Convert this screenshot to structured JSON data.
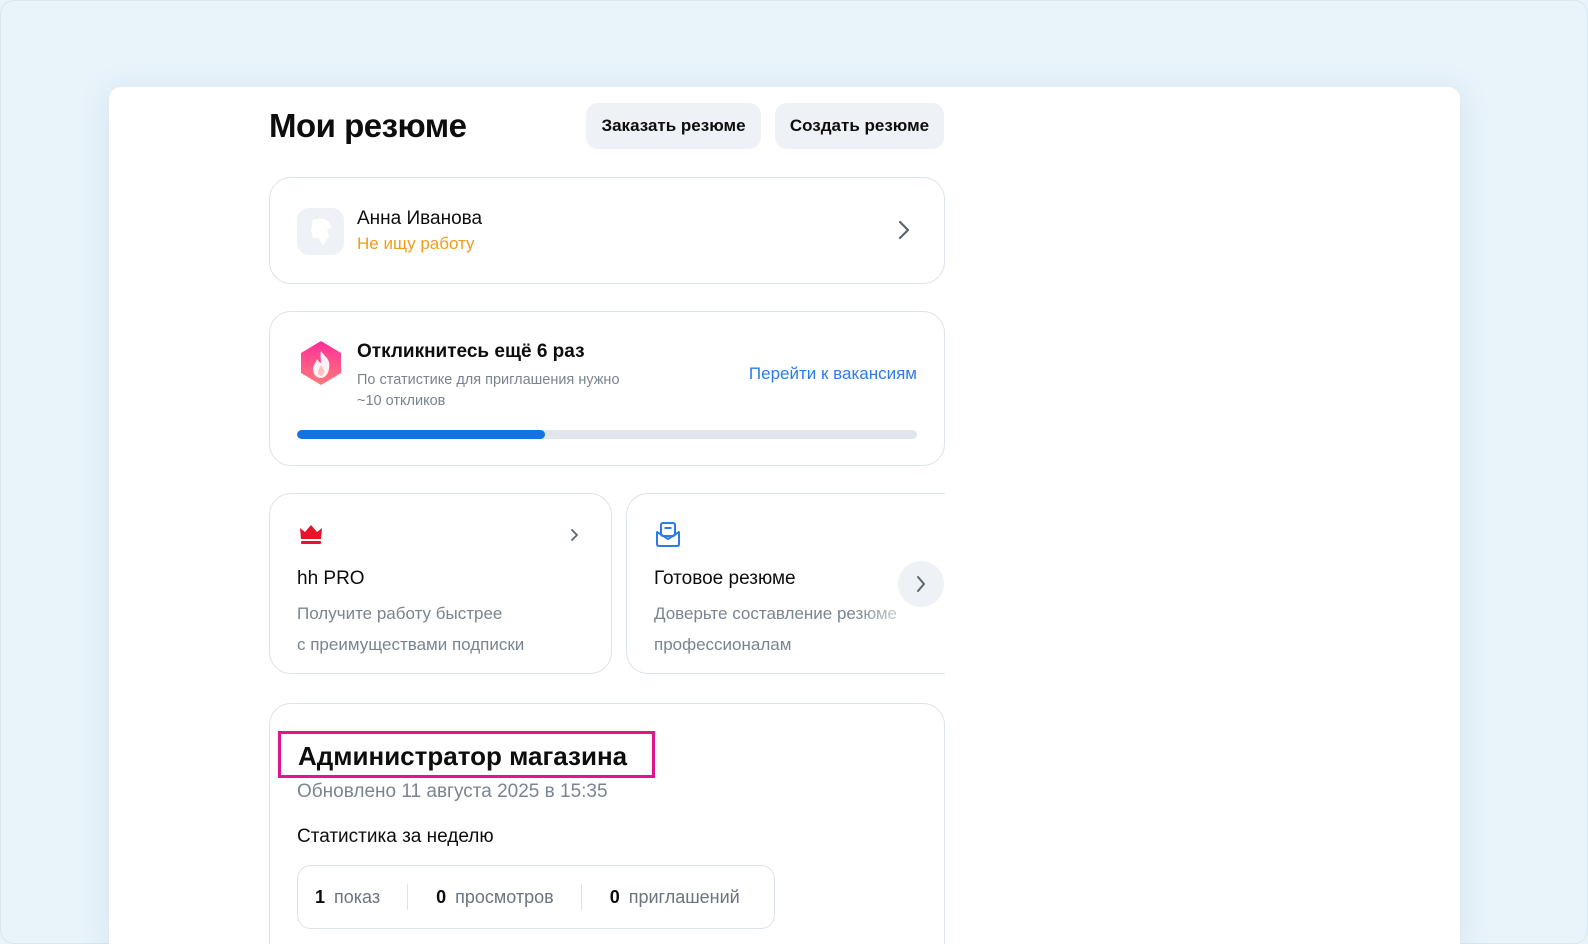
{
  "page": {
    "title": "Мои резюме",
    "buttons": {
      "order": "Заказать резюме",
      "create": "Создать резюме"
    }
  },
  "profile": {
    "name": "Анна Иванова",
    "status": "Не ищу работу",
    "status_color": "#f39c1b"
  },
  "response_card": {
    "title": "Откликнитесь ещё 6 раз",
    "description_line1": "По статистике для приглашения нужно",
    "description_line2": "~10 откликов",
    "link": "Перейти к вакансиям",
    "progress_percent": 40,
    "progress_color": "#1372e6"
  },
  "promos": [
    {
      "icon": "crown-icon",
      "title": "hh PRO",
      "line1": "Получите работу быстрее",
      "line2": "с преимуществами подписки"
    },
    {
      "icon": "envelope-resume-icon",
      "title": "Готовое резюме",
      "line1": "Доверьте составление резюме",
      "line2": "профессионалам"
    }
  ],
  "resume": {
    "title": "Администратор магазина",
    "updated": "Обновлено 11 августа 2025 в 15:35",
    "stats_label": "Статистика за неделю",
    "stats": [
      {
        "value": "1",
        "label": "показ"
      },
      {
        "value": "0",
        "label": "просмотров"
      },
      {
        "value": "0",
        "label": "приглашений"
      }
    ],
    "highlight_color": "#e0168a"
  },
  "colors": {
    "accent_link": "#2b7ce9",
    "background": "#e8f3fa"
  }
}
